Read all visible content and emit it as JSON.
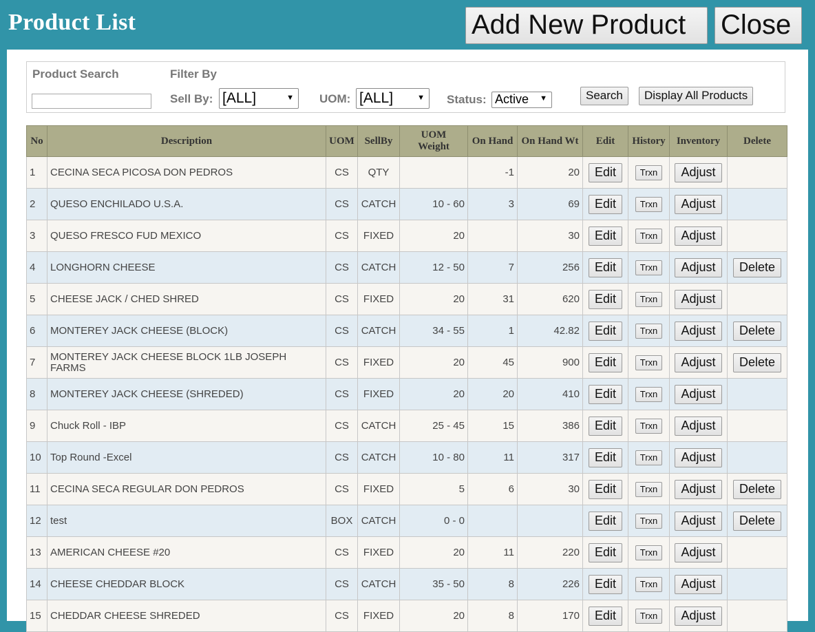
{
  "header": {
    "title": "Product List",
    "add_label": "Add New Product",
    "close_label": "Close"
  },
  "filters": {
    "search_label": "Product Search",
    "search_value": "",
    "filter_label": "Filter By",
    "sellby_label": "Sell By:",
    "sellby_value": "[ALL]",
    "uom_label": "UOM:",
    "uom_value": "[ALL]",
    "status_label": "Status:",
    "status_value": "Active",
    "search_button": "Search",
    "display_all_button": "Display All Products"
  },
  "table": {
    "headers": {
      "no": "No",
      "description": "Description",
      "uom": "UOM",
      "sellby": "SellBy",
      "uom_weight": "UOM Weight",
      "on_hand": "On Hand",
      "on_hand_wt": "On Hand Wt",
      "edit": "Edit",
      "history": "History",
      "inventory": "Inventory",
      "delete": "Delete"
    },
    "button_labels": {
      "edit": "Edit",
      "trxn": "Trxn",
      "adjust": "Adjust",
      "delete": "Delete"
    },
    "rows": [
      {
        "no": "1",
        "desc": "CECINA SECA PICOSA DON PEDROS",
        "uom": "CS",
        "sellby": "QTY",
        "weight": "",
        "onhand": "-1",
        "onhandwt": "20",
        "deletable": false
      },
      {
        "no": "2",
        "desc": "QUESO ENCHILADO U.S.A.",
        "uom": "CS",
        "sellby": "CATCH",
        "weight": "10 - 60",
        "onhand": "3",
        "onhandwt": "69",
        "deletable": false
      },
      {
        "no": "3",
        "desc": "QUESO FRESCO FUD MEXICO",
        "uom": "CS",
        "sellby": "FIXED",
        "weight": "20",
        "onhand": "",
        "onhandwt": "30",
        "deletable": false
      },
      {
        "no": "4",
        "desc": "LONGHORN CHEESE",
        "uom": "CS",
        "sellby": "CATCH",
        "weight": "12 - 50",
        "onhand": "7",
        "onhandwt": "256",
        "deletable": true
      },
      {
        "no": "5",
        "desc": "CHEESE JACK / CHED SHRED",
        "uom": "CS",
        "sellby": "FIXED",
        "weight": "20",
        "onhand": "31",
        "onhandwt": "620",
        "deletable": false
      },
      {
        "no": "6",
        "desc": "MONTEREY JACK CHEESE (BLOCK)",
        "uom": "CS",
        "sellby": "CATCH",
        "weight": "34 - 55",
        "onhand": "1",
        "onhandwt": "42.82",
        "deletable": true
      },
      {
        "no": "7",
        "desc": "MONTEREY JACK CHEESE BLOCK 1LB JOSEPH FARMS",
        "uom": "CS",
        "sellby": "FIXED",
        "weight": "20",
        "onhand": "45",
        "onhandwt": "900",
        "deletable": true
      },
      {
        "no": "8",
        "desc": "MONTEREY JACK CHEESE (SHREDED)",
        "uom": "CS",
        "sellby": "FIXED",
        "weight": "20",
        "onhand": "20",
        "onhandwt": "410",
        "deletable": false
      },
      {
        "no": "9",
        "desc": "Chuck Roll - IBP",
        "uom": "CS",
        "sellby": "CATCH",
        "weight": "25 - 45",
        "onhand": "15",
        "onhandwt": "386",
        "deletable": false
      },
      {
        "no": "10",
        "desc": "Top Round -Excel",
        "uom": "CS",
        "sellby": "CATCH",
        "weight": "10 - 80",
        "onhand": "11",
        "onhandwt": "317",
        "deletable": false
      },
      {
        "no": "11",
        "desc": "CECINA SECA REGULAR DON PEDROS",
        "uom": "CS",
        "sellby": "FIXED",
        "weight": "5",
        "onhand": "6",
        "onhandwt": "30",
        "deletable": true
      },
      {
        "no": "12",
        "desc": "test",
        "uom": "BOX",
        "sellby": "CATCH",
        "weight": "0 - 0",
        "onhand": "",
        "onhandwt": "",
        "deletable": true
      },
      {
        "no": "13",
        "desc": "AMERICAN CHEESE #20",
        "uom": "CS",
        "sellby": "FIXED",
        "weight": "20",
        "onhand": "11",
        "onhandwt": "220",
        "deletable": false
      },
      {
        "no": "14",
        "desc": "CHEESE CHEDDAR BLOCK",
        "uom": "CS",
        "sellby": "CATCH",
        "weight": "35 - 50",
        "onhand": "8",
        "onhandwt": "226",
        "deletable": false
      },
      {
        "no": "15",
        "desc": "CHEDDAR CHEESE SHREDED",
        "uom": "CS",
        "sellby": "FIXED",
        "weight": "20",
        "onhand": "8",
        "onhandwt": "170",
        "deletable": false
      }
    ]
  },
  "colors": {
    "background": "#3194a8",
    "header_row": "#adad8b",
    "row_odd": "#f7f5f1",
    "row_even": "#e2ecf3"
  }
}
